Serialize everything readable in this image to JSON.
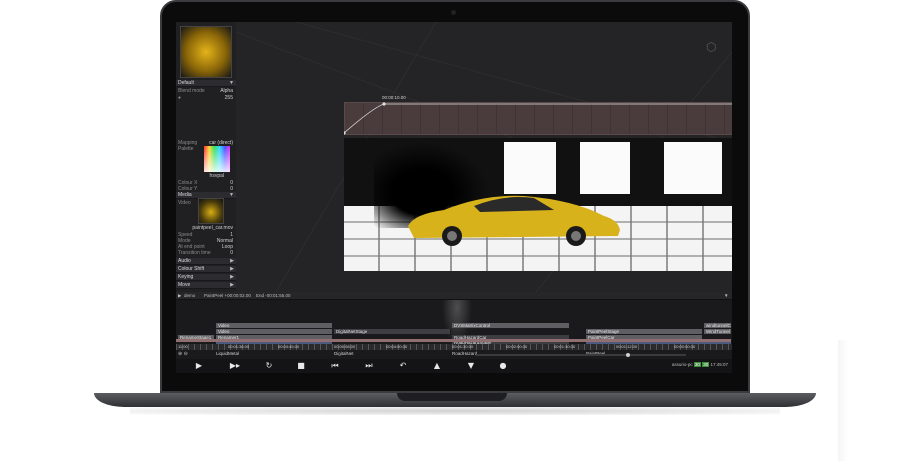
{
  "app": {
    "inspector": {
      "preset": "Default",
      "blend_mode_label": "Blend mode",
      "blend_mode_value": "Alpha",
      "opacity_value": "255",
      "mapping_label": "Mapping",
      "mapping_value": "car (direct)",
      "palette_label": "Palette",
      "palette_name": "hsvpal",
      "colour_x_label": "Colour X",
      "colour_x_value": "0",
      "colour_y_label": "Colour Y",
      "colour_y_value": "0",
      "media_section": "Media",
      "video_label": "Video",
      "video_file": "paintpeel_car.mov",
      "speed_label": "Speed",
      "speed_value": "1",
      "mode_label": "Mode",
      "mode_value": "Normal",
      "at_end_label": "At end point",
      "at_end_value": "Loop",
      "transition_label": "Transition time",
      "transition_value": "0",
      "sections": [
        "Audio",
        "Colour Shift",
        "Keying",
        "Move"
      ]
    },
    "viewport": {
      "curve_time": "00:00:10.00",
      "curve_max": "255",
      "curve_min": "0",
      "nav_icon": "cube-icon"
    },
    "timeline": {
      "header_name": "demo",
      "header_clip": "PaintPeel +00:00:02.00",
      "header_end": "End -00:01:55.00",
      "rows": {
        "row1": [
          "Video",
          "DVSMatrixControl",
          "windtunnelC"
        ],
        "row2": [
          "Video",
          "DigitalNetStage",
          "PaintPeelStage",
          "WindTunnel"
        ],
        "row3": [
          "RenameStage1",
          "Renamer1",
          "RoadHazardCar",
          "PaintPeelCar"
        ],
        "row4": [
          "RoadHazardStage"
        ]
      },
      "ruler": [
        "11:00",
        "00:01:36.00",
        "00:03:45.00",
        "00:00:08.00",
        "00:04:00.00",
        "00:01:30.00",
        "00:02:00.00",
        "00:01:30.00",
        "00:01:12.00",
        "00:00:00.00"
      ],
      "scene_names": [
        "LiquidMetal",
        "DigitalNet",
        "RoadHazard",
        "PaintPeel"
      ],
      "status_host": "assurio-pc",
      "status_fps_a": "30",
      "status_fps_b": "30",
      "status_time": "17:45:07"
    }
  }
}
